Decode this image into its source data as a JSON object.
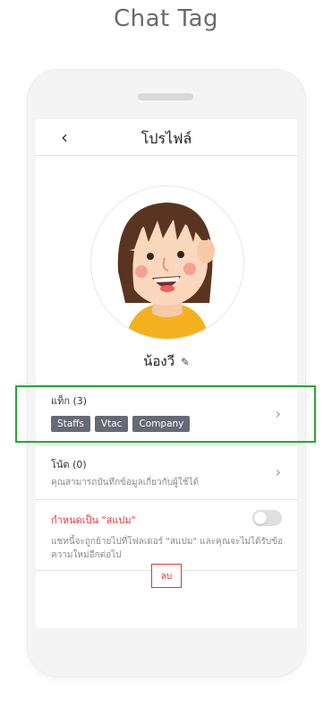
{
  "page": {
    "caption": "Chat Tag"
  },
  "header": {
    "back_icon": "chevron-left-icon",
    "title": "โปรไฟล์"
  },
  "profile": {
    "name": "น้องวี",
    "edit_icon": "pencil-icon"
  },
  "tags_section": {
    "title": "แท็ก (3)",
    "tags": [
      "Staffs",
      "Vtac",
      "Company"
    ],
    "highlight_color": "#2aa534"
  },
  "notes_section": {
    "title": "โน้ต (0)",
    "subtitle": "คุณสามารถบันทึกข้อมูลเกี่ยวกับผู้ใช้ได้"
  },
  "spam_section": {
    "title": "กำหนดเป็น \"สแปม\"",
    "description_line1": "แชทนี้จะถูกย้ายไปที่โฟลเดอร์ \"สแปม\" และคุณจะไม่ได้รับข้อ",
    "description_line2": "ความใหม่อีกต่อไป",
    "toggle_on": false,
    "accent_color": "#d93a3a"
  },
  "actions": {
    "delete_label": "ลบ"
  },
  "system_nav": {
    "back_glyph": "‹",
    "home_glyph": "◯",
    "recents_glyph": "|||"
  }
}
